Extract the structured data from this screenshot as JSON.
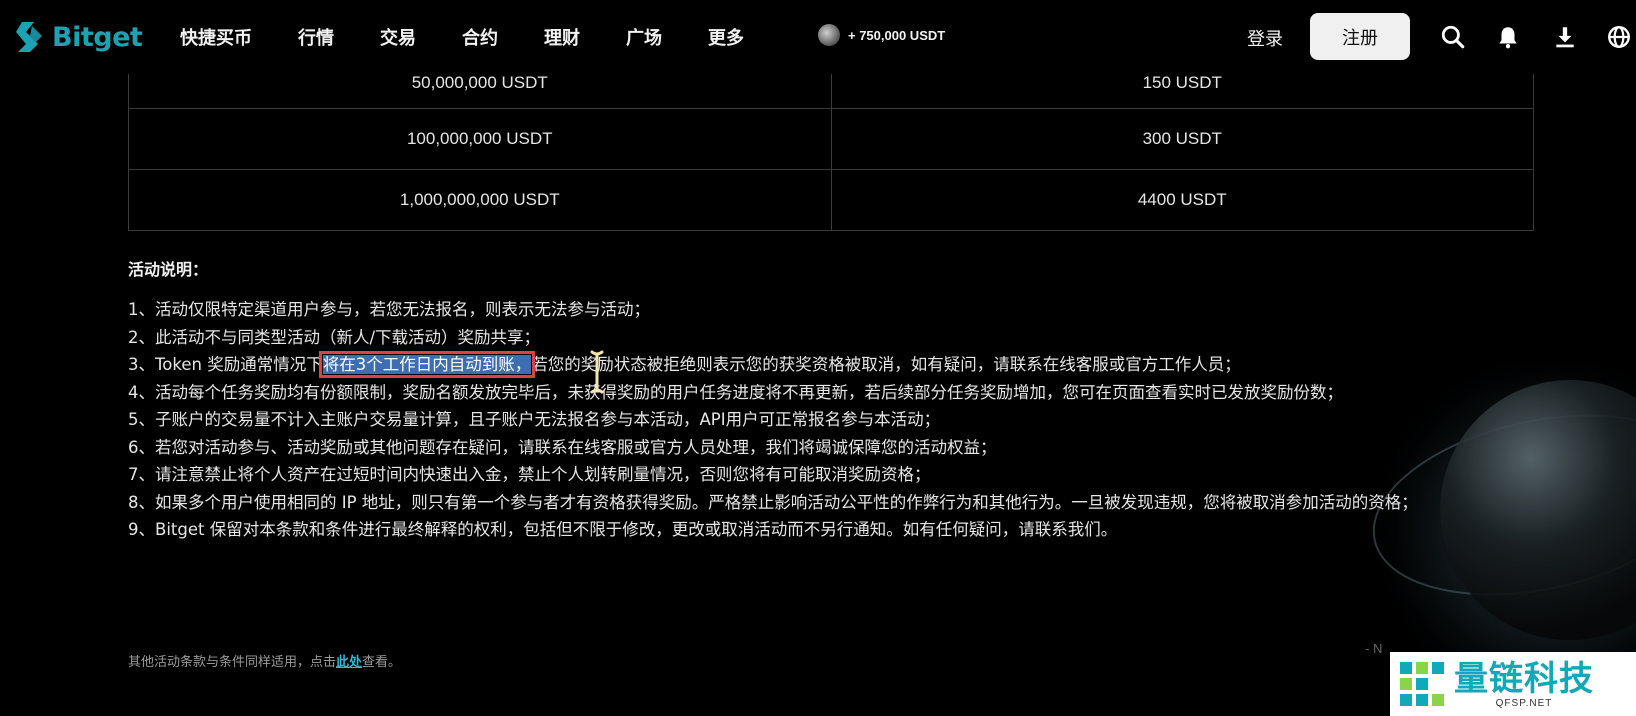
{
  "nav": {
    "logo_text": "Bitget",
    "items": [
      "快捷买币",
      "行情",
      "交易",
      "合约",
      "理财",
      "广场",
      "更多"
    ],
    "promo_text": "+ 750,000 USDT",
    "login_label": "登录",
    "register_label": "注册"
  },
  "table": {
    "rows": [
      [
        "50,000,000 USDT",
        "150 USDT"
      ],
      [
        "100,000,000 USDT",
        "300 USDT"
      ],
      [
        "1,000,000,000 USDT",
        "4400 USDT"
      ]
    ]
  },
  "description": {
    "title": "活动说明：",
    "rules": [
      "1、活动仅限特定渠道用户参与，若您无法报名，则表示无法参与活动；",
      "2、此活动不与同类型活动（新人/下载活动）奖励共享；",
      "4、活动每个任务奖励均有份额限制，奖励名额发放完毕后，未获得奖励的用户任务进度将不再更新，若后续部分任务奖励增加，您可在页面查看实时已发放奖励份数；",
      "5、子账户的交易量不计入主账户交易量计算，且子账户无法报名参与本活动，API用户可正常报名参与本活动；",
      "6、若您对活动参与、活动奖励或其他问题存在疑问，请联系在线客服或官方人员处理，我们将竭诚保障您的活动权益；",
      "7、请注意禁止将个人资产在过短时间内快速出入金，禁止个人划转刷量情况，否则您将有可能取消奖励资格；",
      "8、如果多个用户使用相同的 IP 地址，则只有第一个参与者才有资格获得奖励。严格禁止影响活动公平性的作弊行为和其他行为。一旦被发现违规，您将被取消参加活动的资格；",
      "9、Bitget 保留对本条款和条件进行最终解释的权利，包括但不限于修改，更改或取消活动而不另行通知。如有任何疑问，请联系我们。"
    ],
    "rule3_prefix": "3、Token 奖励通常情况下",
    "rule3_highlight": "将在3个工作日内自动到账，",
    "rule3_suffix": "若您的奖励状态被拒绝则表示您的获奖资格被取消，如有疑问，请联系在线客服或官方工作人员；"
  },
  "footer": {
    "prefix": "其他活动条款与条件同样适用，点击",
    "link": "此处",
    "suffix": "查看。",
    "ghost": "- N"
  },
  "watermark": {
    "cn": "量链科技",
    "en": "QFSP.NET"
  }
}
